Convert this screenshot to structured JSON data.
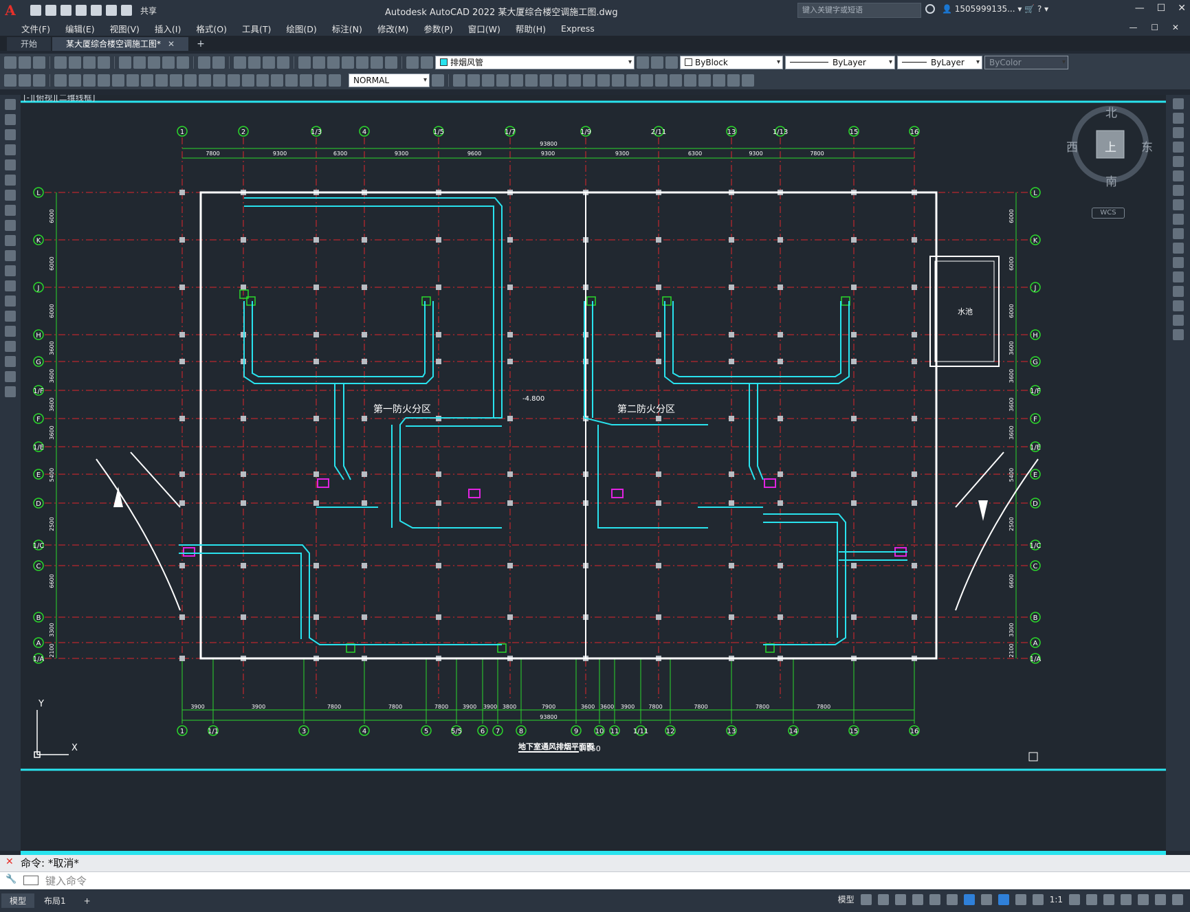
{
  "window": {
    "app_logo": "A",
    "title": "Autodesk AutoCAD 2022    某大厦综合楼空调施工图.dwg",
    "share_label": "共享",
    "search_placeholder": "键入关键字或短语",
    "user_id": "1505999135...",
    "icons": [
      "new-icon",
      "open-icon",
      "save-icon",
      "saveas-icon",
      "plot-icon",
      "undo-icon",
      "redo-icon",
      "share-icon",
      "search-icon",
      "user-icon",
      "cart-icon",
      "help-icon",
      "minimize-icon",
      "maximize-icon",
      "close-icon"
    ]
  },
  "menu": {
    "items": [
      "文件(F)",
      "编辑(E)",
      "视图(V)",
      "插入(I)",
      "格式(O)",
      "工具(T)",
      "绘图(D)",
      "标注(N)",
      "修改(M)",
      "参数(P)",
      "窗口(W)",
      "帮助(H)",
      "Express"
    ]
  },
  "tabs": {
    "items": [
      "开始",
      "某大厦综合楼空调施工图*"
    ],
    "active_index": 1,
    "add_label": "+"
  },
  "toolbar": {
    "layer_value": "排烟风管",
    "layer_color": "#29e3ee",
    "color_value": "ByBlock",
    "linetype_value": "ByLayer",
    "lineweight_value": "ByLayer",
    "plotstyle_value": "ByColor",
    "dimstyle_value": "NORMAL"
  },
  "viewcube": {
    "north": "北",
    "south": "南",
    "east": "东",
    "west": "西",
    "face": "上",
    "wcs": "WCS"
  },
  "drawing": {
    "view_label": "[-][俯视][二维线框]",
    "zone_1": "第一防火分区",
    "zone_2": "第二防火分区",
    "total_dim": "93800",
    "top_axes": [
      "1",
      "2",
      "1/3",
      "4",
      "1/5",
      "1/7",
      "1/9",
      "2/11",
      "13",
      "1/13",
      "15",
      "16"
    ],
    "top_dims": [
      "7800",
      "9300",
      "6300",
      "9300",
      "9600",
      "9300",
      "9300",
      "6300",
      "9300",
      "7800"
    ],
    "bottom_axes": [
      "1",
      "1/1",
      "3",
      "4",
      "5",
      "5/5",
      "6",
      "7",
      "8",
      "9",
      "10",
      "11",
      "1/11",
      "12",
      "13",
      "14",
      "15",
      "16"
    ],
    "bottom_dims": [
      "3900",
      "3900",
      "7800",
      "7800",
      "7800",
      "3900",
      "3900",
      "3800",
      "7900",
      "3600",
      "3600",
      "3900",
      "7800",
      "7800",
      "7800",
      "7800"
    ],
    "row_axes": [
      "L",
      "K",
      "J",
      "H",
      "G",
      "1/F",
      "F",
      "1/E",
      "E",
      "D",
      "1/C",
      "C",
      "B",
      "A",
      "1/A"
    ],
    "row_dims": [
      "6000",
      "6000",
      "6000",
      "3600",
      "3600",
      "3600",
      "3600",
      "5400",
      "2500",
      "6600",
      "3300",
      "2100"
    ],
    "water_pool": "水池",
    "elevation": "-4.800",
    "plan_title": "地下室通风排烟平面图",
    "plan_scale": "1:150",
    "ucs_x": "X",
    "ucs_y": "Y"
  },
  "command": {
    "history": "命令: *取消*",
    "prompt_placeholder": "键入命令"
  },
  "status": {
    "model_tab": "模型",
    "layout_tab": "布局1",
    "add_label": "+",
    "model_label": "模型",
    "scale": "1:1"
  }
}
